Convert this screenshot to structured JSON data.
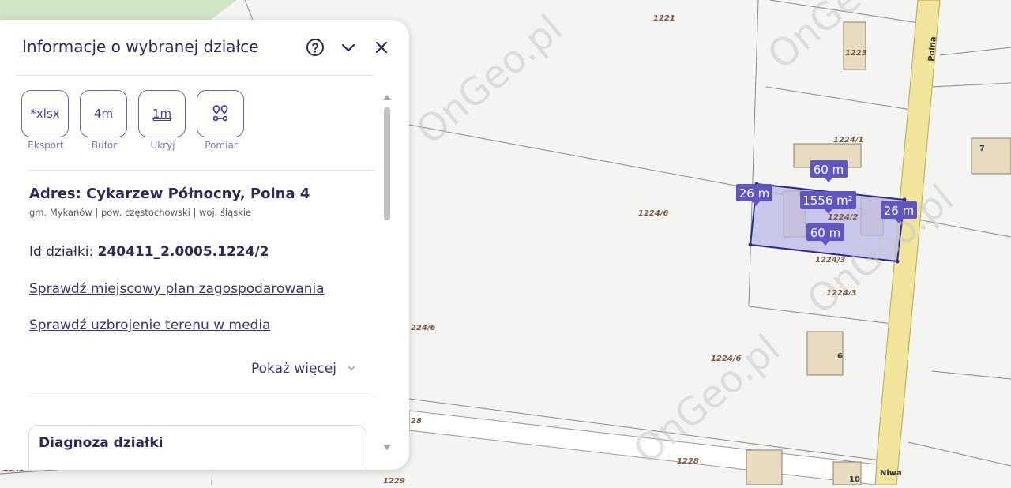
{
  "map": {
    "watermarks": [
      "OnGeo.pl",
      "OnGeo.pl",
      "OnGeo.pl",
      "OnGeo.pl"
    ],
    "street_polna": "Polna",
    "street_niwa": "Niwa",
    "parcel_labels": {
      "p1221": "1221",
      "p1223": "1223",
      "p1224_1": "1224/1",
      "p1224_6a": "1224/6",
      "p1224_2": "1224/2",
      "p1224_3a": "1224/3",
      "p1224_3b": "1224/3",
      "p1224_6b": "224/6",
      "p1224_6c": "1224/6",
      "p1228": "1228",
      "p28": "28",
      "p1229": "1229",
      "p1843": "1843"
    },
    "house_numbers": {
      "h7": "7",
      "h6": "6",
      "h10": "10"
    },
    "measurements": {
      "top": "60 m",
      "bottom": "60 m",
      "left": "26 m",
      "right": "26 m",
      "area": "1556 m²"
    }
  },
  "panel": {
    "title": "Informacje o wybranej działce",
    "tools": [
      {
        "label": "*xlsx",
        "caption": "Eksport"
      },
      {
        "label": "4m",
        "caption": "Bufor"
      },
      {
        "label": "1m",
        "caption": "Ukryj"
      },
      {
        "label": "",
        "caption": "Pomiar"
      }
    ],
    "address_title": "Adres: Cykarzew Północny, Polna 4",
    "address_sub": "gm. Mykanów | pow. częstochowski | woj. śląskie",
    "id_label": "Id działki:",
    "id_value": "240411_2.0005.1224/2",
    "link_plan": "Sprawdź miejscowy plan zagospodarowania",
    "link_media": "Sprawdź uzbrojenie terenu w media",
    "show_more": "Pokaż więcej",
    "diagnosis_title": "Diagnoza działki"
  },
  "colors": {
    "accent": "#5f56c4",
    "title": "#2c2957",
    "parcel_fill": "#b9b8e6",
    "parcel_stroke": "#2e2a8f",
    "road": "#f0e59a"
  }
}
